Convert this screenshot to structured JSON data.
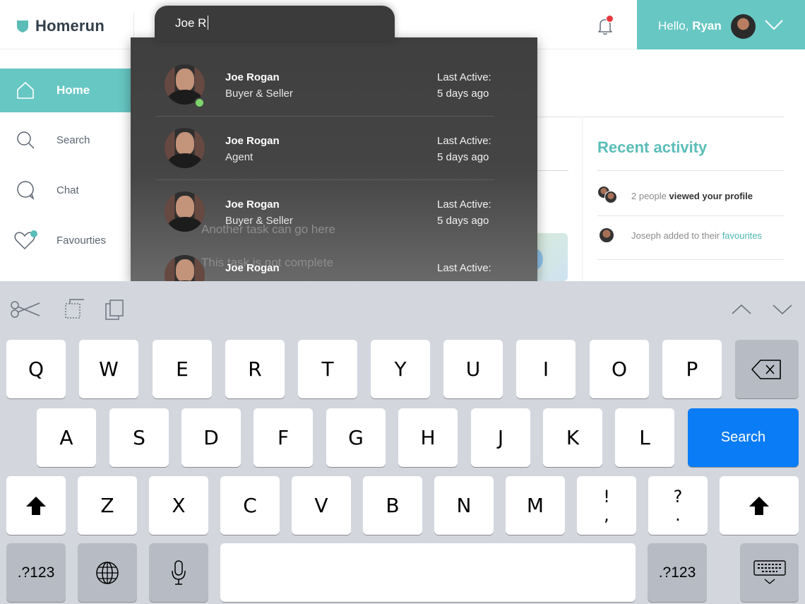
{
  "app": {
    "brand": "Homerun",
    "accent_color": "#67c7c3",
    "notification_count": "1"
  },
  "user": {
    "greeting": "Hello,",
    "name": "Ryan"
  },
  "sidebar": {
    "items": [
      {
        "label": "Home",
        "icon": "home-icon",
        "active": true
      },
      {
        "label": "Search",
        "icon": "search-icon",
        "active": false
      },
      {
        "label": "Chat",
        "icon": "chat-icon",
        "active": false
      },
      {
        "label": "Favourties",
        "icon": "heart-icon",
        "active": false
      }
    ]
  },
  "search": {
    "query": "Joe R",
    "results": [
      {
        "name": "Joe Rogan",
        "role": "Buyer & Seller",
        "last_active_label": "Last Active:",
        "last_active_value": "5 days ago",
        "online": true
      },
      {
        "name": "Joe Rogan",
        "role": "Agent",
        "last_active_label": "Last Active:",
        "last_active_value": "5 days ago",
        "online": false
      },
      {
        "name": "Joe Rogan",
        "role": "Buyer & Seller",
        "last_active_label": "Last Active:",
        "last_active_value": "5 days ago",
        "online": false
      },
      {
        "name": "Joe Rogan",
        "role": "",
        "last_active_label": "Last Active:",
        "last_active_value": "",
        "online": false
      }
    ]
  },
  "background": {
    "task_1": "Another task can go here",
    "task_2": "This task is not complete"
  },
  "activity": {
    "title": "Recent activity",
    "rows": [
      {
        "prefix": "2 people",
        "bold": "viewed your profile",
        "suffix": ""
      },
      {
        "prefix": "Joseph",
        "bold": "",
        "suffix": "added to their",
        "accent": "favourites"
      }
    ]
  },
  "keyboard": {
    "row1": [
      "Q",
      "W",
      "E",
      "R",
      "T",
      "Y",
      "U",
      "I",
      "O",
      "P"
    ],
    "row2": [
      "A",
      "S",
      "D",
      "F",
      "G",
      "H",
      "J",
      "K",
      "L"
    ],
    "row3": [
      "Z",
      "X",
      "C",
      "V",
      "B",
      "N",
      "M"
    ],
    "punct1": {
      "top": "!",
      "bottom": ","
    },
    "punct2": {
      "top": "?",
      "bottom": "."
    },
    "numbers_label": ".?123",
    "action_label": "Search",
    "action_color": "#0a7cf6"
  }
}
